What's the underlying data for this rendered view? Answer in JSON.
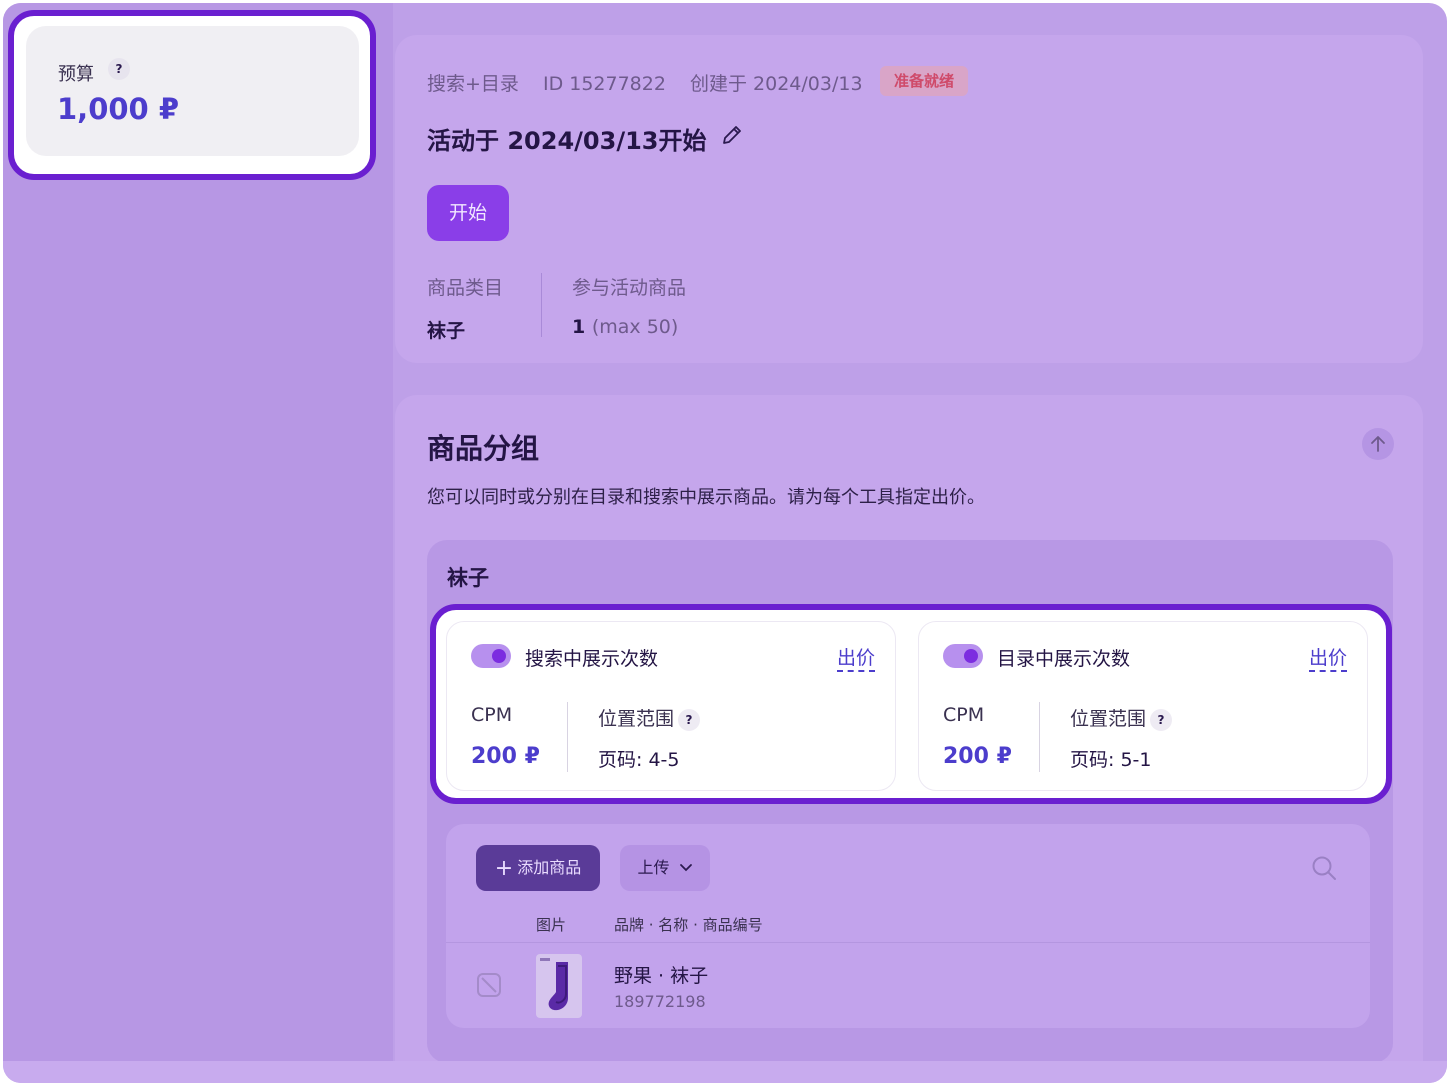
{
  "budget": {
    "label": "预算",
    "help": "?",
    "value": "1,000 ₽"
  },
  "campaign": {
    "type": "搜索+目录",
    "id_text": "ID 15277822",
    "created": "创建于 2024/03/13",
    "status": "准备就绪",
    "title": "活动于 2024/03/13开始",
    "start_label": "开始",
    "category_label": "商品类目",
    "category_value": "袜子",
    "products_label": "参与活动商品",
    "products_count": "1",
    "products_max": "(max 50)"
  },
  "groups": {
    "title": "商品分组",
    "description": "您可以同时或分别在目录和搜索中展示商品。请为每个工具指定出价。",
    "group_name": "袜子",
    "placements": [
      {
        "title": "搜索中展示次数",
        "bid_label": "出价",
        "enabled": true,
        "cpm_label": "CPM",
        "cpm_value": "200 ₽",
        "position_label": "位置范围",
        "position_value": "页码: 4-5"
      },
      {
        "title": "目录中展示次数",
        "bid_label": "出价",
        "enabled": true,
        "cpm_label": "CPM",
        "cpm_value": "200 ₽",
        "position_label": "位置范围",
        "position_value": "页码: 5-1"
      }
    ],
    "products": {
      "add_label": "添加商品",
      "upload_label": "上传",
      "columns": [
        "图片",
        "品牌 · 名称 · 商品编号"
      ],
      "rows": [
        {
          "name": "野果 · 袜子",
          "sku": "189772198"
        }
      ]
    }
  },
  "colors": {
    "accent": "#6a1fd0",
    "price": "#4c3dcc",
    "status_text": "#cf4b6a",
    "background": "#bea0e8"
  },
  "icons": [
    "help-icon",
    "edit-pencil-icon",
    "arrow-up-icon",
    "plus-icon",
    "chevron-down-icon",
    "search-icon",
    "disabled-checkbox-icon",
    "sock-product-image"
  ]
}
